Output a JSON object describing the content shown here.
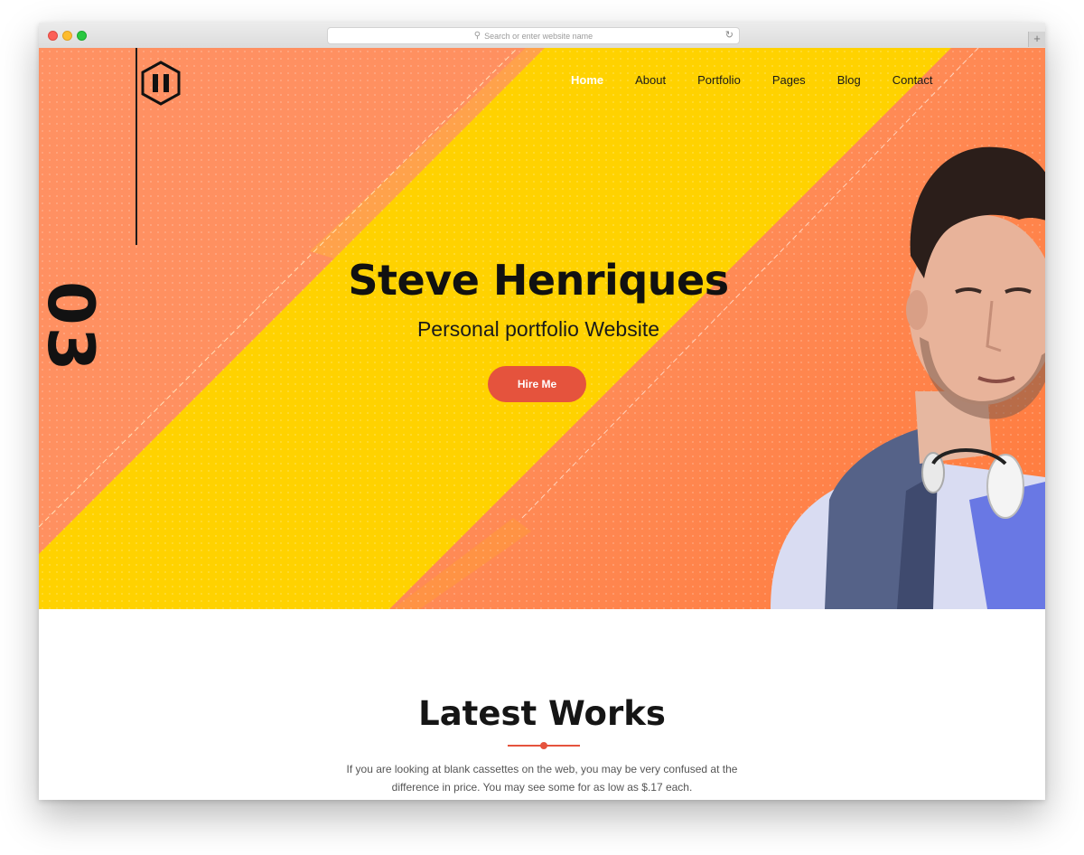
{
  "browser": {
    "url_placeholder": "Search or enter website name"
  },
  "nav": {
    "items": [
      "Home",
      "About",
      "Portfolio",
      "Pages",
      "Blog",
      "Contact"
    ],
    "active": "Home"
  },
  "hero": {
    "slide_number": "03",
    "title": "Steve Henriques",
    "subtitle": "Personal portfolio Website",
    "cta_label": "Hire Me"
  },
  "works": {
    "title": "Latest Works",
    "description": "If you are looking at blank cassettes on the web, you may be very confused at the difference in price. You may see some for as low as $.17 each."
  },
  "colors": {
    "accent": "#e5533d",
    "hero_orange": "#ff8f5e",
    "hero_yellow": "#ffd200"
  }
}
